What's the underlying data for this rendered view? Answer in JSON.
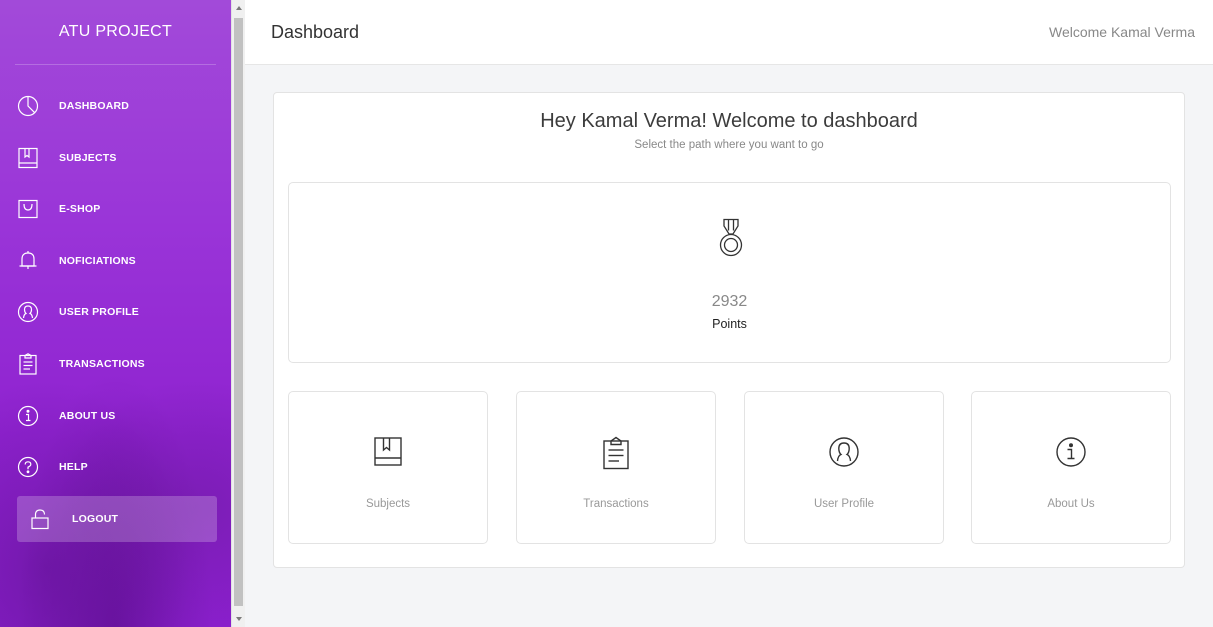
{
  "sidebar": {
    "brand": "ATU PROJECT",
    "items": [
      {
        "label": "DASHBOARD",
        "icon": "pie-chart-icon"
      },
      {
        "label": "SUBJECTS",
        "icon": "book-icon"
      },
      {
        "label": "E-SHOP",
        "icon": "shopping-bag-icon"
      },
      {
        "label": "NOFICIATIONS",
        "icon": "bell-icon"
      },
      {
        "label": "USER PROFILE",
        "icon": "user-icon"
      },
      {
        "label": "TRANSACTIONS",
        "icon": "clipboard-icon"
      },
      {
        "label": "ABOUT US",
        "icon": "info-icon"
      },
      {
        "label": "HELP",
        "icon": "question-icon"
      },
      {
        "label": "LOGOUT",
        "icon": "lock-icon"
      }
    ]
  },
  "header": {
    "title": "Dashboard",
    "welcome": "Welcome Kamal Verma"
  },
  "main": {
    "heading": "Hey Kamal Verma! Welcome to dashboard",
    "subheading": "Select the path where you want to go",
    "points": {
      "value": "2932",
      "label": "Points",
      "icon": "medal-icon"
    },
    "tiles": [
      {
        "label": "Subjects",
        "icon": "book-icon"
      },
      {
        "label": "Transactions",
        "icon": "clipboard-icon"
      },
      {
        "label": "User Profile",
        "icon": "user-icon"
      },
      {
        "label": "About Us",
        "icon": "info-icon"
      }
    ]
  },
  "colors": {
    "sidebar_top": "#a24ad9",
    "sidebar_bottom": "#8a1fcc",
    "background": "#f4f5f7"
  }
}
